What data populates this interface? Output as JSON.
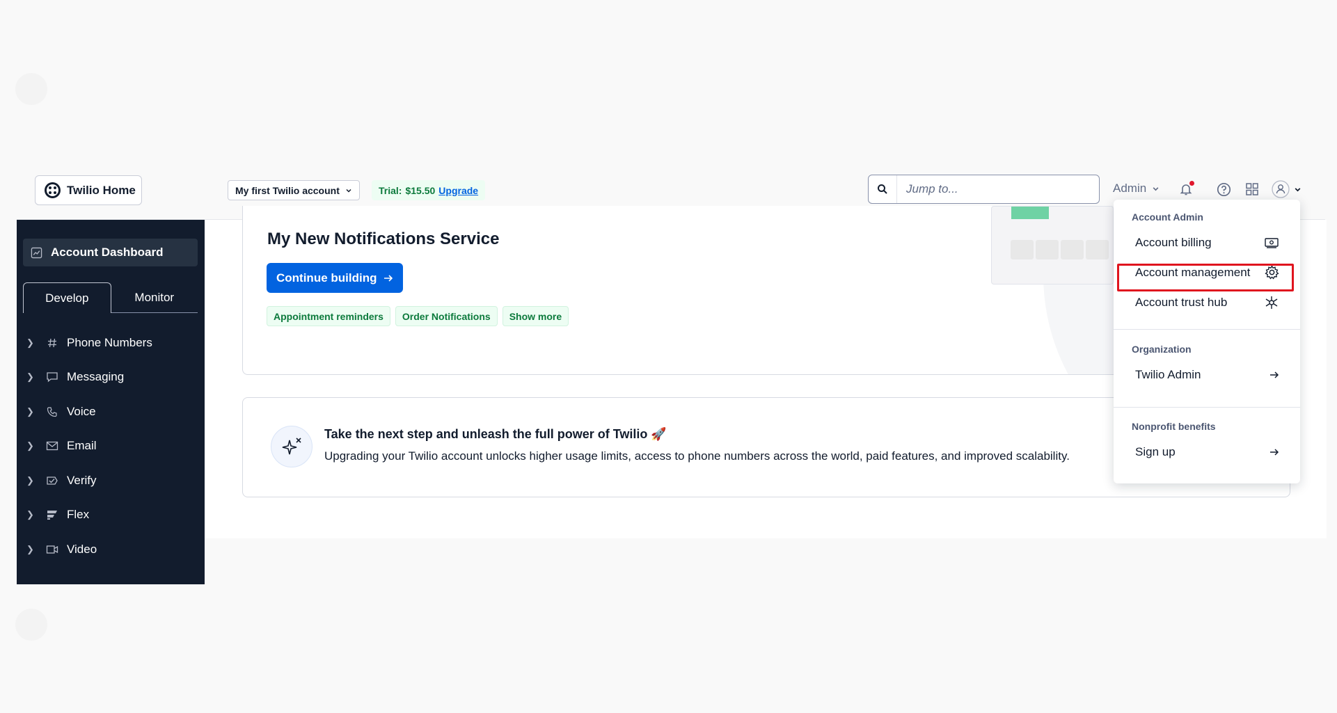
{
  "header": {
    "home_label": "Twilio Home",
    "account_label": "My first Twilio account",
    "trial_label": "Trial:",
    "trial_amount": "$15.50",
    "upgrade_label": "Upgrade",
    "search_placeholder": "Jump to...",
    "admin_label": "Admin"
  },
  "sidebar": {
    "dashboard_label": "Account Dashboard",
    "tabs": [
      {
        "label": "Develop",
        "active": true
      },
      {
        "label": "Monitor",
        "active": false
      }
    ],
    "items": [
      {
        "label": "Phone Numbers",
        "icon": "hash-icon"
      },
      {
        "label": "Messaging",
        "icon": "chat-icon"
      },
      {
        "label": "Voice",
        "icon": "phone-icon"
      },
      {
        "label": "Email",
        "icon": "mail-icon"
      },
      {
        "label": "Verify",
        "icon": "verify-icon"
      },
      {
        "label": "Flex",
        "icon": "flex-icon"
      },
      {
        "label": "Video",
        "icon": "video-icon"
      }
    ]
  },
  "main": {
    "card1": {
      "title": "My New Notifications Service",
      "continue_label": "Continue building",
      "tags": [
        "Appointment reminders",
        "Order Notifications",
        "Show more"
      ]
    },
    "card2": {
      "title": "Take the next step and unleash the full power of Twilio 🚀",
      "body": "Upgrading your Twilio account unlocks higher usage limits, access to phone numbers across the world, paid features, and improved scalability."
    }
  },
  "dropdown": {
    "account_admin_heading": "Account Admin",
    "account_items": [
      {
        "label": "Account billing",
        "icon": "billing-icon"
      },
      {
        "label": "Account management",
        "icon": "gear-icon"
      },
      {
        "label": "Account trust hub",
        "icon": "hub-icon"
      }
    ],
    "organization_heading": "Organization",
    "organization_item": "Twilio Admin",
    "nonprofit_heading": "Nonprofit benefits",
    "nonprofit_item": "Sign up"
  },
  "colors": {
    "primary": "#0263e0",
    "sidebar_bg": "#121c2d",
    "success_text": "#0c7a3c",
    "highlight": "#e0141e"
  }
}
